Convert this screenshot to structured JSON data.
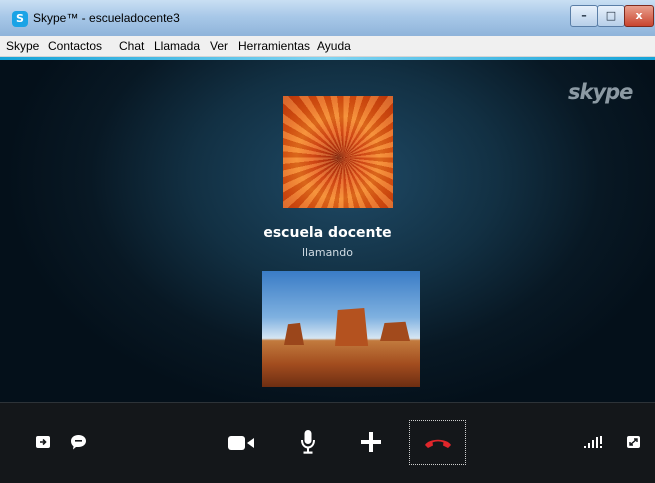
{
  "window": {
    "title": "Skype™ - escueladocente3",
    "app_icon_letter": "S",
    "controls": {
      "minimize": "–",
      "maximize": "□",
      "close": "x"
    }
  },
  "menu": {
    "items": [
      "Skype",
      "Contactos",
      "Chat",
      "Llamada",
      "Ver",
      "Herramientas",
      "Ayuda"
    ]
  },
  "call": {
    "watermark": "skype",
    "contact_name": "escuela docente",
    "status": "llamando"
  },
  "toolbar": {
    "icons": [
      "share-screen-icon",
      "chat-icon",
      "video-icon",
      "microphone-icon",
      "add-icon",
      "hang-up-icon",
      "signal-strength-icon",
      "fullscreen-icon"
    ]
  },
  "colors": {
    "accent": "#14a3d8",
    "hangup": "#e0262b",
    "toolbar_bg": "#14171a"
  }
}
